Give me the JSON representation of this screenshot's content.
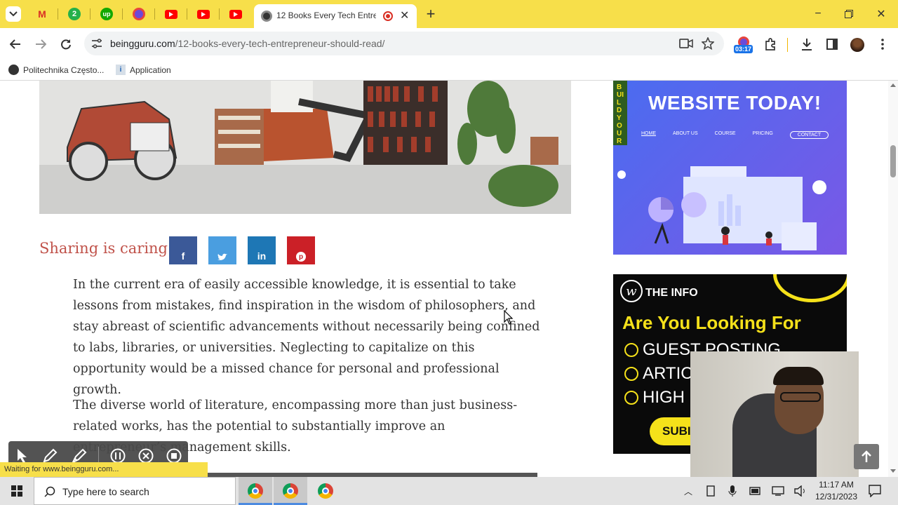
{
  "browser": {
    "active_tab_title": "12 Books Every Tech Entrepr",
    "other_tab_badges": [
      "M",
      "2",
      "up",
      "",
      "",
      "",
      ""
    ],
    "url_domain": "beingguru.com",
    "url_path": "/12-books-every-tech-entrepreneur-should-read/",
    "recording_badge": "03:17",
    "bookmarks": [
      "Politechnika Często...",
      "Application"
    ],
    "status_text": "Waiting for www.beingguru.com..."
  },
  "article": {
    "sharing_label": "Sharing is caring!",
    "share_buttons": [
      "f",
      "",
      "in",
      "p"
    ],
    "paragraph1": "In the current era of easily accessible knowledge, it is essential to take lessons from mistakes, find inspiration in the wisdom of philosophers, and stay abreast of scientific advancements without necessarily being confined to labs, libraries, or universities. Neglecting to capitalize on this opportunity would be a missed chance for personal and professional growth.",
    "paragraph2": "The diverse world of literature, encompassing more than just business-related works, has the potential to substantially improve an entrepreneur’s management skills."
  },
  "ads": {
    "ad1_vertical": "BUILD YOUR",
    "ad1_headline": "WEBSITE TODAY!",
    "ad1_nav": [
      "HOME",
      "ABOUT US",
      "COURSE",
      "PRICING",
      "CONTACT"
    ],
    "ad2_brand": "THE INFO",
    "ad2_headline": "Are You Looking For",
    "ad2_items": [
      "GUEST POSTING",
      "ARTIC",
      "HIGH"
    ],
    "ad2_button": "SUBI"
  },
  "taskbar": {
    "search_placeholder": "Type here to search",
    "time": "11:17 AM",
    "date": "12/31/2023"
  },
  "colors": {
    "tabstrip": "#f7df4a",
    "sharing": "#c0524a",
    "facebook": "#3b5998",
    "twitter": "#4a9ee0",
    "linkedin": "#1e77b5",
    "pinterest": "#cb2027",
    "ad1_bg": "#6b55e0",
    "ad2_bg": "#0a0a0a",
    "ad2_yellow": "#f5e11a"
  }
}
